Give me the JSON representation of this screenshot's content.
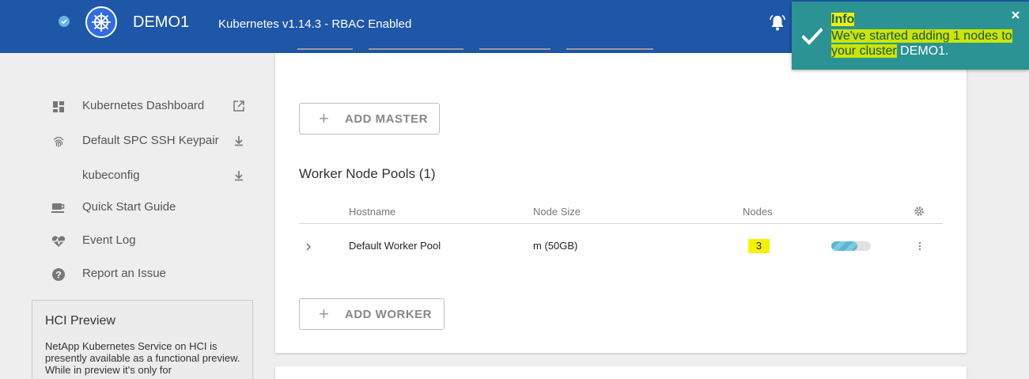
{
  "header": {
    "cluster_name": "DEMO1",
    "cluster_info": "Kubernetes v1.14.3 - RBAC Enabled"
  },
  "toast": {
    "title": "Info",
    "message_highlighted": "We've started adding 1 nodes to your cluster",
    "message_rest": " DEMO1."
  },
  "sidebar": {
    "items": [
      {
        "label": "Kubernetes Dashboard",
        "icon": "dashboard-icon",
        "action_icon": "external-link-icon"
      },
      {
        "label": "Default SPC SSH Keypair",
        "icon": "fingerprint-icon",
        "action_icon": "download-icon"
      },
      {
        "label": "kubeconfig",
        "icon": "",
        "action_icon": "download-icon"
      },
      {
        "label": "Quick Start Guide",
        "icon": "coffee-icon",
        "action_icon": ""
      },
      {
        "label": "Event Log",
        "icon": "heart-pulse-icon",
        "action_icon": ""
      },
      {
        "label": "Report an Issue",
        "icon": "help-circle-icon",
        "action_icon": ""
      }
    ]
  },
  "hci": {
    "title": "HCI Preview",
    "text": "NetApp Kubernetes Service on HCI is presently available as a functional preview. While in preview it's only for"
  },
  "main": {
    "add_master_label": "ADD MASTER",
    "worker_section_title": "Worker Node Pools (1)",
    "columns": {
      "hostname": "Hostname",
      "node_size": "Node Size",
      "nodes": "Nodes"
    },
    "rows": [
      {
        "hostname": "Default Worker Pool",
        "node_size": "m (50GB)",
        "nodes": "3",
        "progress": 0.65
      }
    ],
    "add_worker_label": "ADD WORKER"
  },
  "colors": {
    "header": "#1e56a8",
    "toast": "#2b9393",
    "highlight": "#f4f200"
  }
}
